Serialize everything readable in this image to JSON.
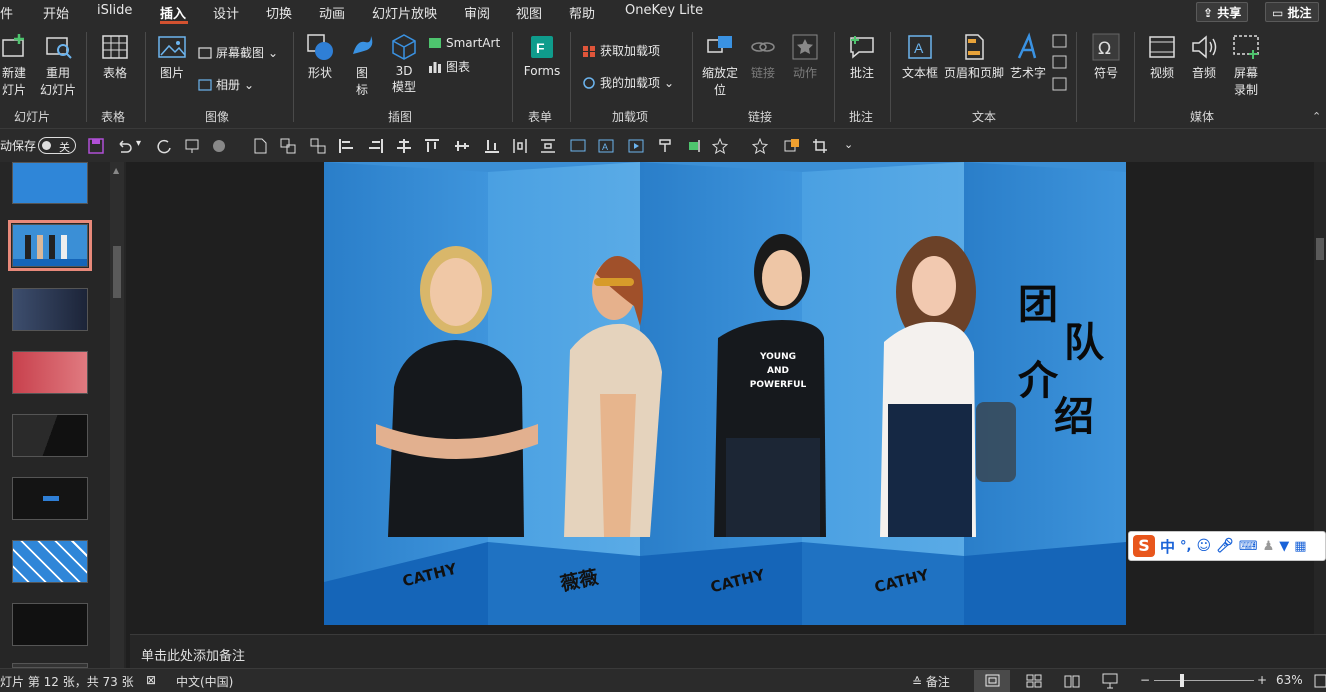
{
  "menu": {
    "tabs": [
      "件",
      "开始",
      "iSlide",
      "插入",
      "设计",
      "切换",
      "动画",
      "幻灯片放映",
      "审阅",
      "视图",
      "帮助",
      "OneKey Lite"
    ],
    "active_tab": "插入",
    "share_label": "共享",
    "comment_label": "批注"
  },
  "ribbon": {
    "new_slide_line1": "新建",
    "new_slide_line2": "灯片",
    "reuse_slide_line1": "重用",
    "reuse_slide_line2": "幻灯片",
    "group_slides": "幻灯片",
    "table": "表格",
    "group_table": "表格",
    "picture": "图片",
    "screenshot": "屏幕截图",
    "album": "相册",
    "group_images": "图像",
    "shapes": "形状",
    "icons_line1": "图",
    "icons_line2": "标",
    "model3d_line1": "3D",
    "model3d_line2": "模型",
    "smartart": "SmartArt",
    "chart": "图表",
    "group_illustrations": "插图",
    "forms": "Forms",
    "group_forms": "表单",
    "get_addins": "获取加载项",
    "my_addins": "我的加载项",
    "group_addins": "加载项",
    "zoom_line1": "缩放定",
    "zoom_line2": "位",
    "link": "链接",
    "action": "动作",
    "group_links": "链接",
    "comment": "批注",
    "group_comments": "批注",
    "textbox": "文本框",
    "header_footer": "页眉和页脚",
    "wordart": "艺术字",
    "group_text": "文本",
    "symbol": "符号",
    "video": "视频",
    "audio": "音频",
    "screen_rec_line1": "屏幕",
    "screen_rec_line2": "录制",
    "group_media": "媒体"
  },
  "qat": {
    "autosave_label": "动保存",
    "autosave_state": "关"
  },
  "slide": {
    "title_chars": [
      "团",
      "队",
      "介",
      "绍"
    ],
    "shirt_text": [
      "YOUNG",
      "AND",
      "POWERFUL"
    ],
    "name_labels": [
      "CATHY",
      "薇薇",
      "CATHY",
      "CATHY"
    ]
  },
  "notes": {
    "placeholder": "单击此处添加备注"
  },
  "status": {
    "slide_info": "灯片 第 12 张，共 73 张",
    "language": "中文(中国)",
    "notes_btn": "备注",
    "zoom_minus": "−",
    "zoom_plus": "+",
    "zoom_level": "63%"
  },
  "ime": {
    "mode": "中",
    "punct": "°,"
  },
  "colors": {
    "accent": "#d35230",
    "slide_blue": "#3b8fd6",
    "slide_dark_blue": "#1565b8",
    "thumb_selected": "#e8897a"
  }
}
